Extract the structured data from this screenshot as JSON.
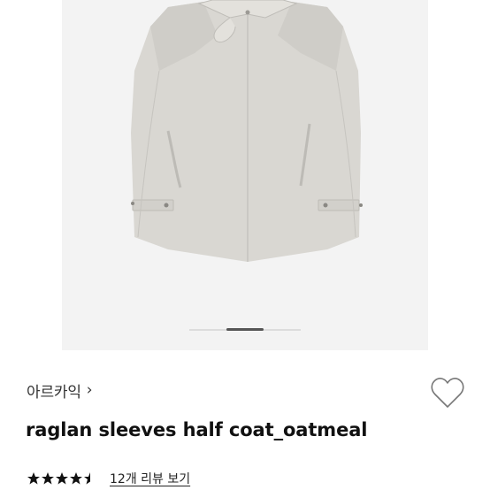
{
  "product": {
    "image_alt": "oatmeal raglan sleeves half coat",
    "gallery": {
      "slide_count": 3,
      "active_slide": 2
    },
    "brand": {
      "name": "아르카익",
      "chevron": "›"
    },
    "title": "raglan sleeves half coat_oatmeal",
    "rating": {
      "value": 4.5,
      "max": 5
    },
    "review_link": "12개 리뷰 보기",
    "wishlist_icon": "heart-outline-icon"
  },
  "colors": {
    "coat": "#d9d7d2",
    "gallery_bg": "#f3f3f3",
    "star": "#111111"
  }
}
